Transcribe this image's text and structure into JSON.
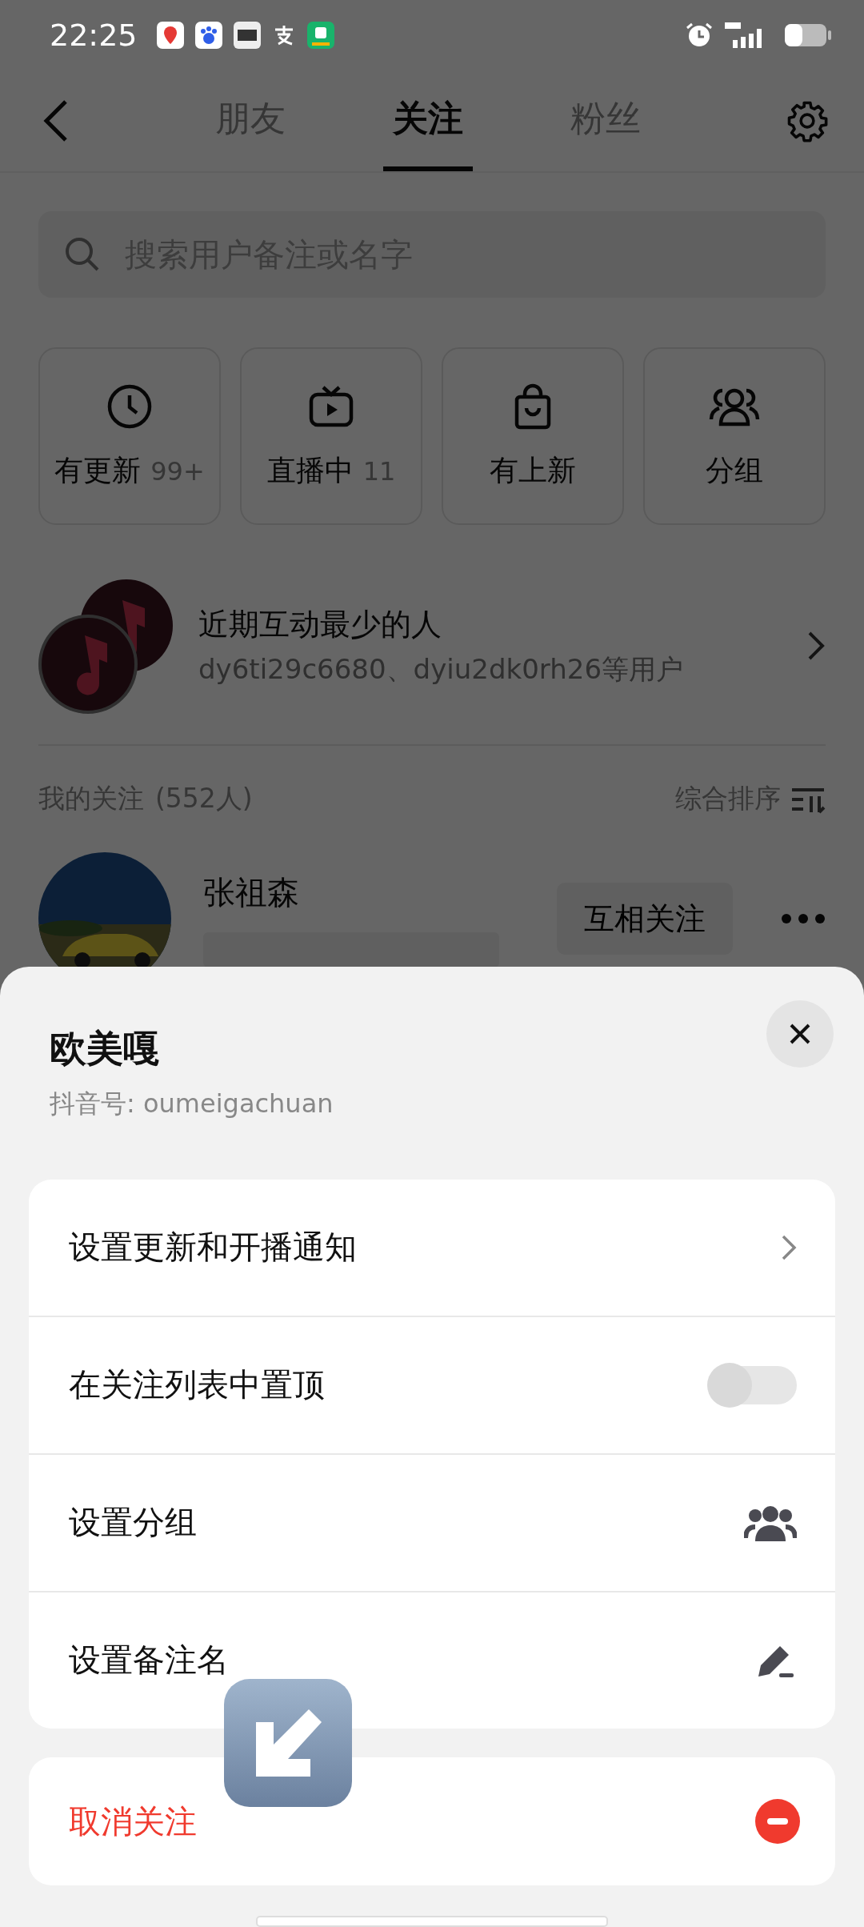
{
  "status_bar": {
    "time": "22:25"
  },
  "header": {
    "tabs": [
      {
        "label": "朋友",
        "selected": false
      },
      {
        "label": "关注",
        "selected": true
      },
      {
        "label": "粉丝",
        "selected": false
      }
    ]
  },
  "search": {
    "placeholder": "搜索用户备注或名字"
  },
  "quick_filters": [
    {
      "kind": "updates",
      "label": "有更新",
      "count": "99+"
    },
    {
      "kind": "live",
      "label": "直播中",
      "count": "11"
    },
    {
      "kind": "new",
      "label": "有上新"
    },
    {
      "kind": "groups",
      "label": "分组"
    }
  ],
  "least_interacted": {
    "title": "近期互动最少的人",
    "subtitle": "dy6ti29c6680、dyiu2dk0rh26等用户"
  },
  "following": {
    "title": "我的关注",
    "count": "(552人)",
    "sort": "综合排序"
  },
  "users": [
    {
      "name": "张祖森",
      "button": "互相关注"
    }
  ],
  "sheet": {
    "title": "欧美嘎",
    "account": "抖音号: oumeigachuan",
    "options": [
      {
        "kind": "link",
        "label": "设置更新和开播通知"
      },
      {
        "kind": "toggle",
        "label": "在关注列表中置顶",
        "on": false
      },
      {
        "kind": "group",
        "label": "设置分组"
      },
      {
        "kind": "rename",
        "label": "设置备注名"
      }
    ],
    "unfollow": "取消关注"
  }
}
